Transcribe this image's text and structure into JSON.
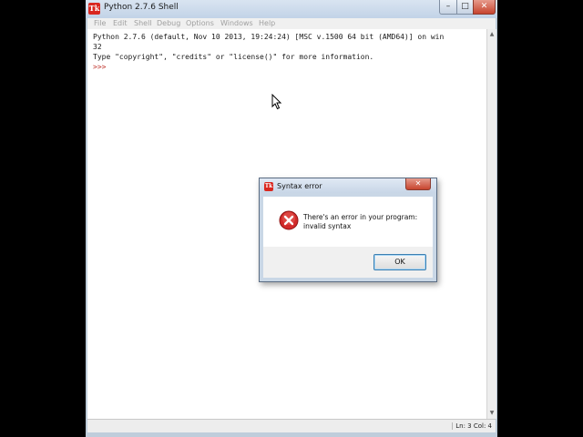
{
  "window": {
    "title": "Python 2.7.6 Shell",
    "icon_label": "Tk",
    "controls": {
      "minimize": "–",
      "maximize": "□",
      "close": "✕"
    }
  },
  "menu": {
    "items": [
      "File",
      "Edit",
      "Shell",
      "Debug",
      "Options",
      "Windows",
      "Help"
    ]
  },
  "shell": {
    "line1": "Python 2.7.6 (default, Nov 10 2013, 19:24:24) [MSC v.1500 64 bit (AMD64)] on win",
    "line2": "32",
    "line3": "Type \"copyright\", \"credits\" or \"license()\" for more information.",
    "prompt": ">>>"
  },
  "statusbar": {
    "position": "Ln: 3 Col: 4"
  },
  "dialog": {
    "title": "Syntax error",
    "icon_label": "Tk",
    "close": "✕",
    "message_line1": "There's an error in your program:",
    "message_line2": "invalid syntax",
    "ok_label": "OK",
    "icon": "error-icon"
  },
  "colors": {
    "prompt": "#c0332b",
    "error": "#d12a2a",
    "accent": "#3c7fb1"
  }
}
